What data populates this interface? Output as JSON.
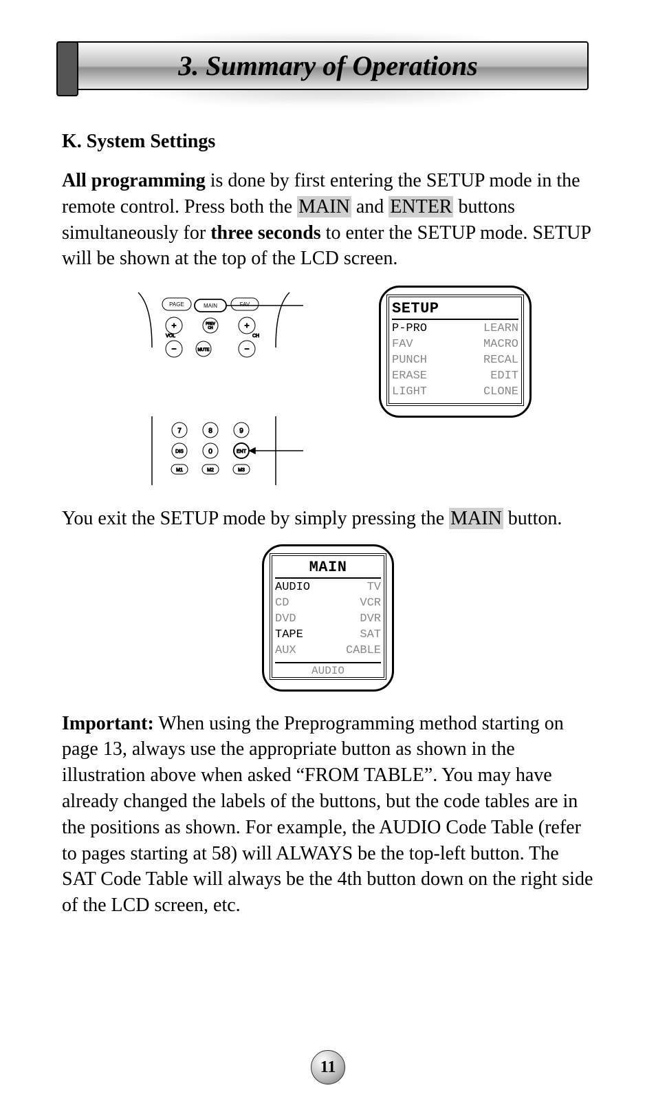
{
  "chapter_title": "3. Summary of Operations",
  "section_heading": "K. System Settings",
  "para1": {
    "lead_bold": "All programming",
    "t1": " is done by first entering the SETUP mode in the remote control. Press both the ",
    "hl1": "MAIN",
    "t2": " and ",
    "hl2": "ENTER",
    "t3": " buttons simultaneously for ",
    "bold2": "three seconds",
    "t4": " to enter the SETUP mode.  SETUP will be shown at the top of the LCD screen."
  },
  "remote_buttons": {
    "top": [
      "PAGE",
      "MAIN",
      "FAV"
    ],
    "rocker_left_top": "+",
    "rocker_left_label": "VOL",
    "rocker_left_bot": "−",
    "mid_left": "PREV CH",
    "mid_right": "MUTE",
    "rocker_right_top": "+",
    "rocker_right_label": "CH",
    "rocker_right_bot": "−",
    "num": [
      "7",
      "8",
      "9",
      "DIS",
      "0",
      "ENT",
      "M1",
      "M2",
      "M3"
    ]
  },
  "setup_lcd": {
    "title": "SETUP",
    "rows": [
      [
        "P-PRO",
        "LEARN"
      ],
      [
        "FAV",
        "MACRO"
      ],
      [
        "PUNCH",
        "RECAL"
      ],
      [
        "ERASE",
        "EDIT"
      ],
      [
        "LIGHT",
        "CLONE"
      ]
    ]
  },
  "para2": {
    "t1": "You exit the SETUP mode by simply pressing the ",
    "hl1": "MAIN",
    "t2": " button."
  },
  "main_lcd": {
    "title": "MAIN",
    "rows": [
      [
        "AUDIO",
        "TV"
      ],
      [
        "CD",
        "VCR"
      ],
      [
        "DVD",
        "DVR"
      ],
      [
        "TAPE",
        "SAT"
      ],
      [
        "AUX",
        "CABLE"
      ]
    ],
    "dark_left": [
      0,
      3
    ],
    "footer": "AUDIO"
  },
  "para3": {
    "lead_bold": "Important:",
    "body": " When using the Preprogramming method starting on page 13, always use the appropriate button as shown in the illustration above when asked “FROM TABLE”. You may have already changed the labels of the buttons, but the code tables are in the positions as shown. For example, the AUDIO Code Table (refer to pages starting at 58) will ALWAYS be the top-left button. The SAT Code Table will always be the 4th button down on the right side of the LCD screen, etc."
  },
  "page_number": "11"
}
